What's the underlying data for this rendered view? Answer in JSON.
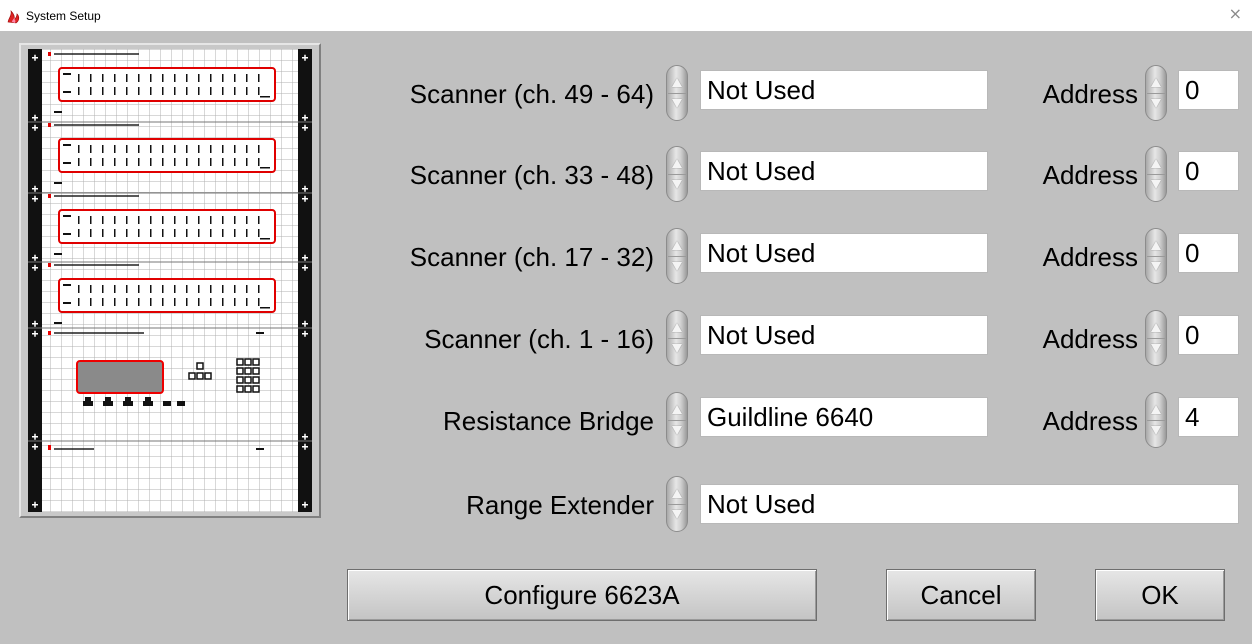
{
  "window": {
    "title": "System Setup",
    "close_glyph": "×"
  },
  "rows": [
    {
      "label": "Scanner (ch. 49 - 64)",
      "value": "Not Used",
      "address_label": "Address",
      "address": "0"
    },
    {
      "label": "Scanner (ch. 33 - 48)",
      "value": "Not Used",
      "address_label": "Address",
      "address": "0"
    },
    {
      "label": "Scanner (ch. 17 - 32)",
      "value": "Not Used",
      "address_label": "Address",
      "address": "0"
    },
    {
      "label": "Scanner (ch. 1 - 16)",
      "value": "Not Used",
      "address_label": "Address",
      "address": "0"
    },
    {
      "label": "Resistance Bridge",
      "value": "Guildline 6640",
      "address_label": "Address",
      "address": "4"
    },
    {
      "label": "Range Extender",
      "value": "Not Used"
    }
  ],
  "buttons": {
    "configure": "Configure 6623A",
    "cancel": "Cancel",
    "ok": "OK"
  },
  "colors": {
    "background": "#c0c0c0",
    "accent_red": "#e00000",
    "field_bg": "#ffffff"
  },
  "icons": {
    "title": "app-flame-icon",
    "preview": "rack-preview-diagram"
  }
}
